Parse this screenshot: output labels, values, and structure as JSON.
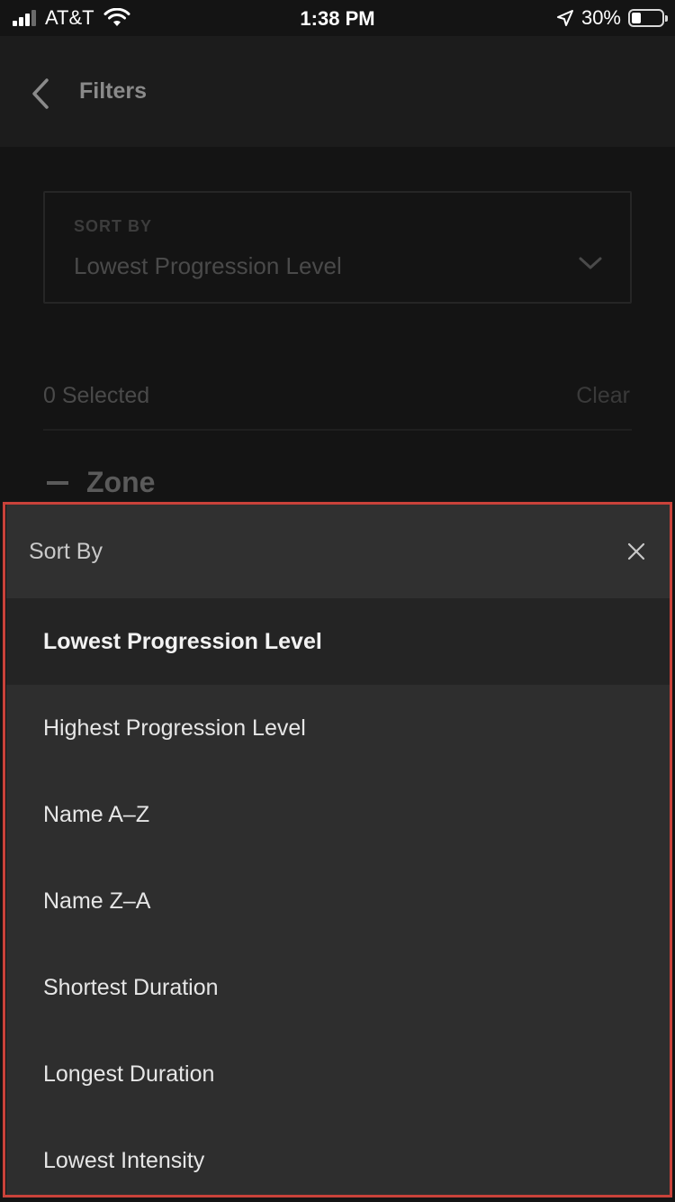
{
  "status_bar": {
    "carrier": "AT&T",
    "time": "1:38 PM",
    "battery_percent": "30%",
    "battery_level": 0.3
  },
  "header": {
    "title": "Filters"
  },
  "sort_select": {
    "label": "SORT BY",
    "value": "Lowest Progression Level"
  },
  "selection": {
    "count_label": "0 Selected",
    "clear_label": "Clear"
  },
  "zone": {
    "label": "Zone"
  },
  "sheet": {
    "title": "Sort By",
    "options": [
      {
        "label": "Lowest Progression Level",
        "selected": true
      },
      {
        "label": "Highest Progression Level",
        "selected": false
      },
      {
        "label": "Name A–Z",
        "selected": false
      },
      {
        "label": "Name Z–A",
        "selected": false
      },
      {
        "label": "Shortest Duration",
        "selected": false
      },
      {
        "label": "Longest Duration",
        "selected": false
      },
      {
        "label": "Lowest Intensity",
        "selected": false
      }
    ]
  },
  "colors": {
    "background": "#141414",
    "sheet": "#2e2e2e",
    "highlight_outline": "#c9423a"
  }
}
